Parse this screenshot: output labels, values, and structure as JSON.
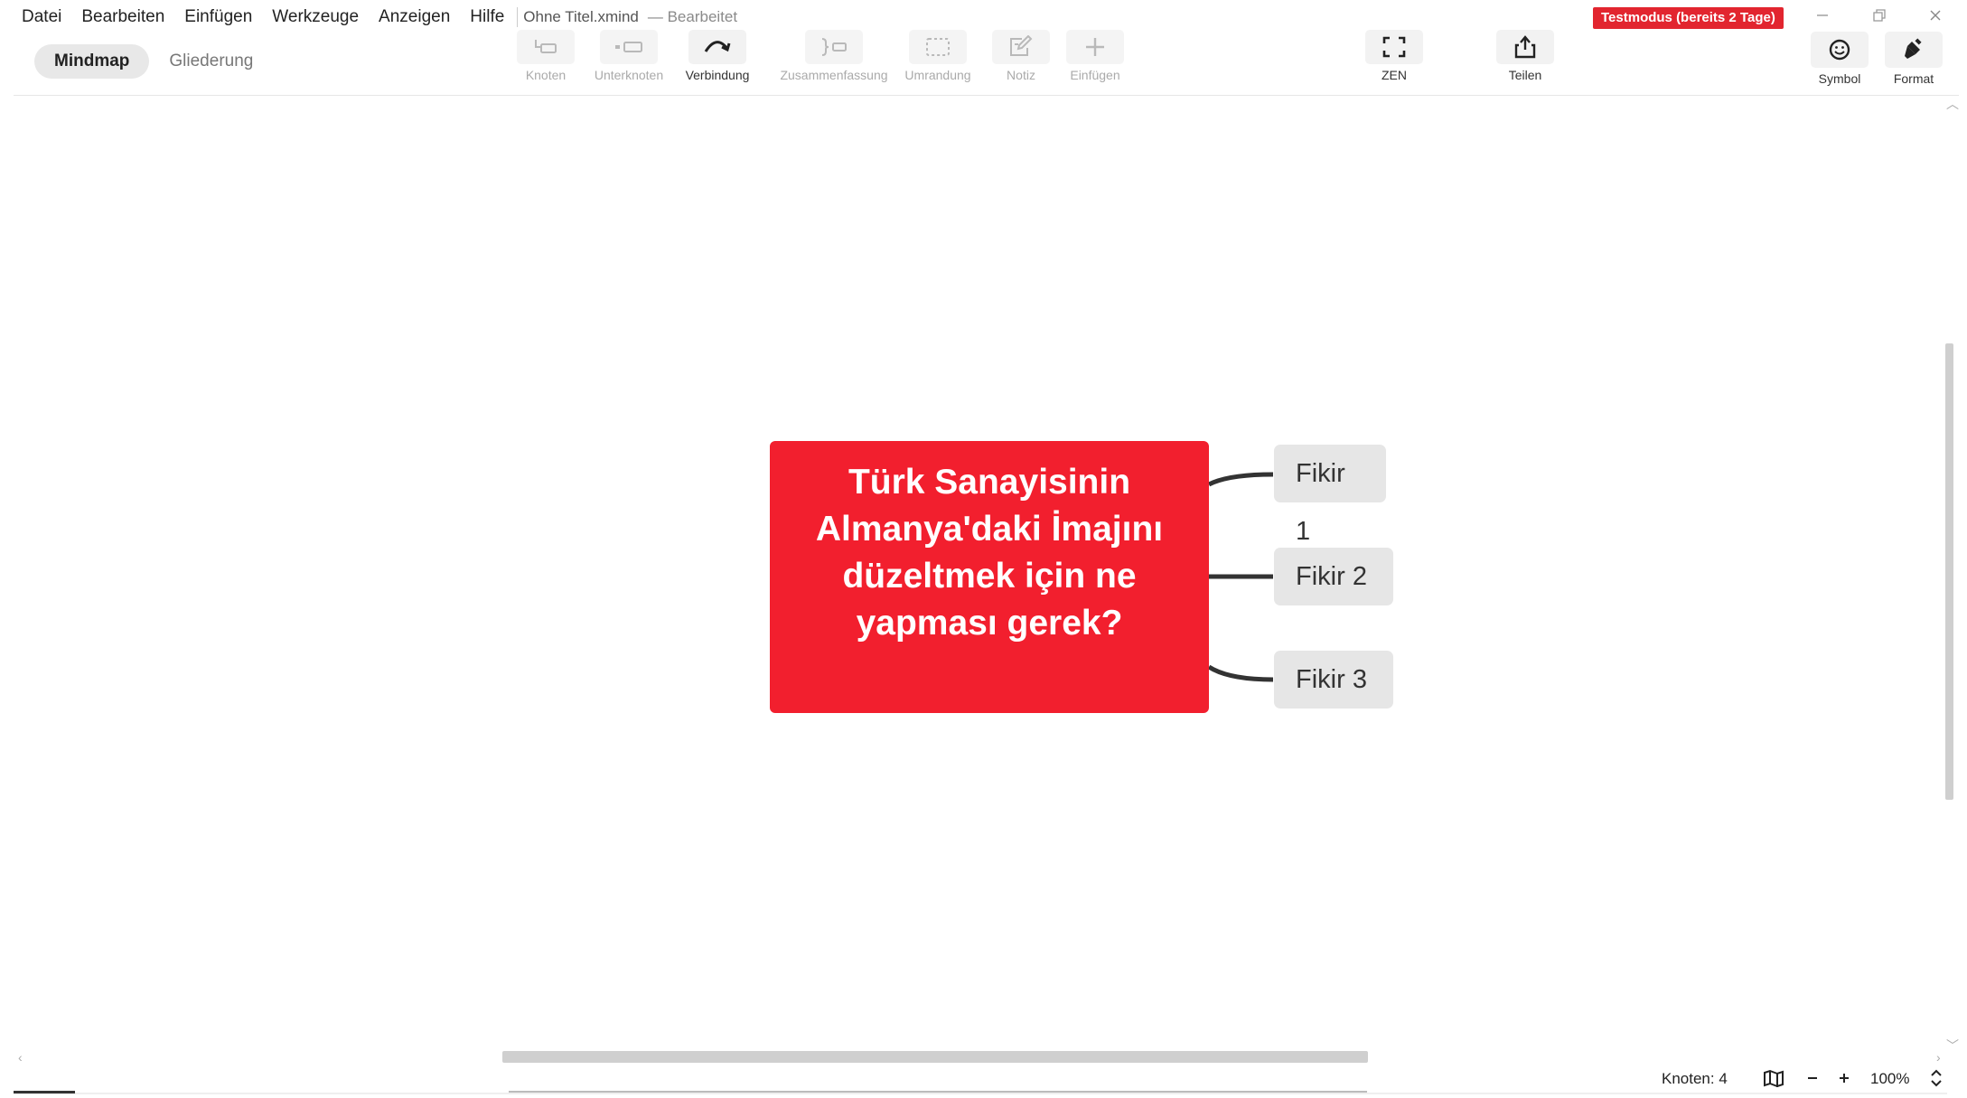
{
  "menu": {
    "items": [
      "Datei",
      "Bearbeiten",
      "Einfügen",
      "Werkzeuge",
      "Anzeigen",
      "Hilfe"
    ],
    "document_title": "Ohne Titel.xmind",
    "document_status": "— Bearbeitet"
  },
  "trial_badge": "Testmodus (bereits 2 Tage)",
  "view_tabs": {
    "mindmap": "Mindmap",
    "outline": "Gliederung"
  },
  "toolbar": {
    "topic": "Knoten",
    "subtopic": "Unterknoten",
    "relationship": "Verbindung",
    "summary": "Zusammenfassung",
    "boundary": "Umrandung",
    "note": "Notiz",
    "insert": "Einfügen",
    "zen": "ZEN",
    "share": "Teilen",
    "symbol": "Symbol",
    "format": "Format"
  },
  "mindmap": {
    "central_topic": "Türk Sanayisinin Almanya'daki İmajını düzeltmek için ne yapması gerek?",
    "subtopics": [
      "Fikir 1",
      "Fikir 2",
      "Fikir 3"
    ]
  },
  "statusbar": {
    "node_count": "Knoten: 4",
    "zoom": "100%"
  },
  "colors": {
    "central_topic_fill": "#f21f2e",
    "subtopic_fill": "#e6e6e6",
    "trial_badge": "#e2252f"
  }
}
